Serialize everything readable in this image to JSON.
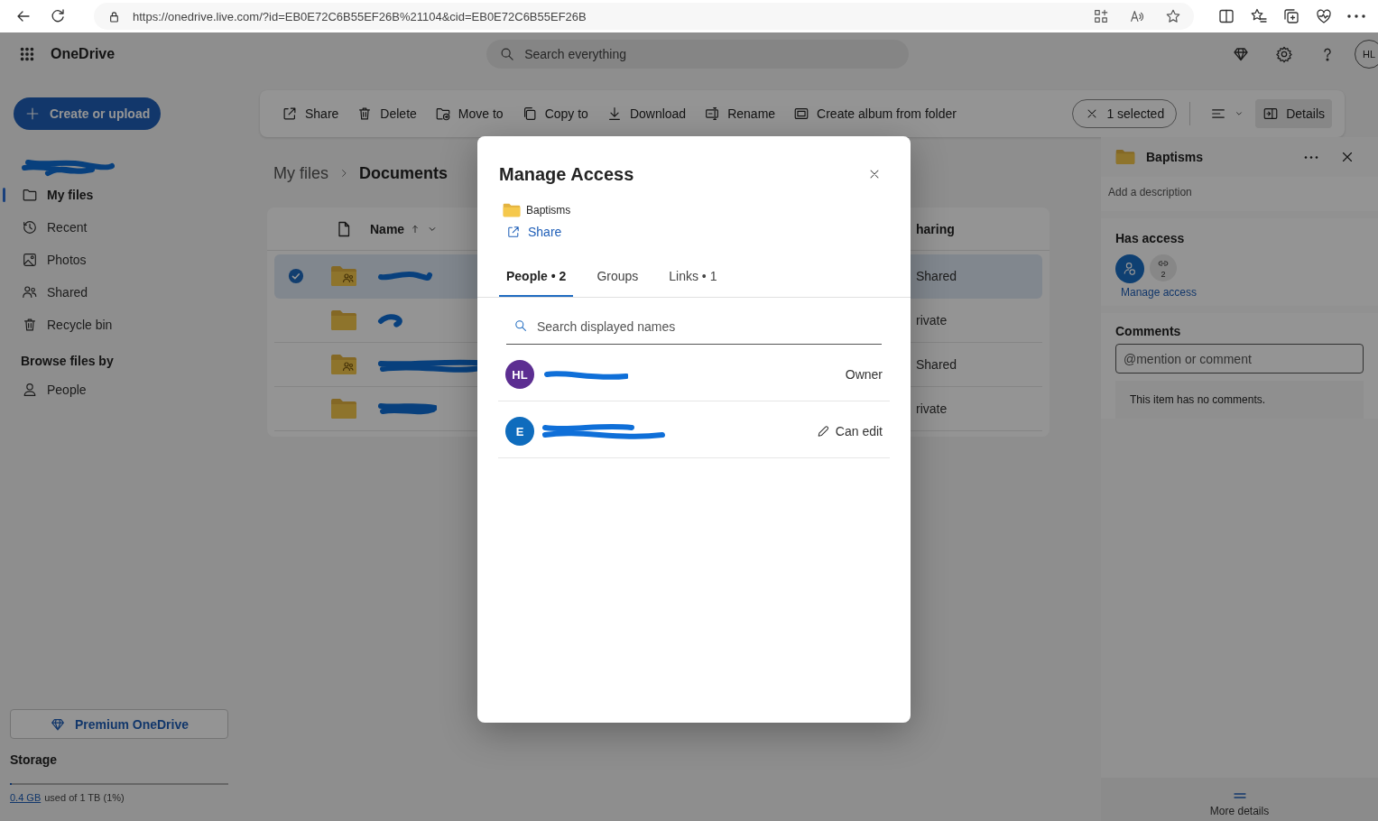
{
  "browser": {
    "url": "https://onedrive.live.com/?id=EB0E72C6B55EF26B%21104&cid=EB0E72C6B55EF26B"
  },
  "app": {
    "name": "OneDrive",
    "search_placeholder": "Search everything",
    "avatar": "HL"
  },
  "sidebar": {
    "create_button": "Create or upload",
    "items": [
      {
        "label": "My files",
        "selected": true
      },
      {
        "label": "Recent",
        "selected": false
      },
      {
        "label": "Photos",
        "selected": false
      },
      {
        "label": "Shared",
        "selected": false
      },
      {
        "label": "Recycle bin",
        "selected": false
      }
    ],
    "browse_heading": "Browse files by",
    "browse_items": [
      {
        "label": "People",
        "selected": false
      }
    ],
    "premium_button": "Premium OneDrive",
    "storage": {
      "heading": "Storage",
      "level": 0.01,
      "used": "0.4 GB",
      "detail": "used of 1 TB (1%)"
    }
  },
  "toolbar": {
    "actions": [
      {
        "label": "Share"
      },
      {
        "label": "Delete"
      },
      {
        "label": "Move to"
      },
      {
        "label": "Copy to"
      },
      {
        "label": "Download"
      },
      {
        "label": "Rename"
      },
      {
        "label": "Create album from folder"
      }
    ],
    "selection": "1 selected",
    "details_button": "Details"
  },
  "breadcrumb": [
    "My files",
    "Documents"
  ],
  "file_list": {
    "name_column": "Name",
    "sharing_column": "haring",
    "rows": [
      {
        "shared": true,
        "selected": true,
        "sharing": "Shared"
      },
      {
        "shared": false,
        "selected": false,
        "sharing": "rivate"
      },
      {
        "shared": true,
        "selected": false,
        "sharing": "Shared"
      },
      {
        "shared": false,
        "selected": false,
        "sharing": "rivate"
      }
    ]
  },
  "dialog": {
    "title": "Manage Access",
    "item": "Baptisms",
    "share_link": "Share",
    "tabs": [
      {
        "label": "People • 2",
        "selected": true
      },
      {
        "label": "Groups",
        "selected": false
      },
      {
        "label": "Links • 1",
        "selected": false
      }
    ],
    "search_placeholder": "Search displayed names",
    "people": [
      {
        "kind": "owner",
        "initials": "HL",
        "color": "#5c2e91",
        "role": "Owner"
      },
      {
        "kind": "editor",
        "initials": "E",
        "color": "#0f6cbd",
        "role": "Can edit"
      }
    ]
  },
  "details": {
    "title": "Baptisms",
    "description_placeholder": "Add a description",
    "has_access_heading": "Has access",
    "link_count": "2",
    "manage_access": "Manage access",
    "comments_heading": "Comments",
    "comment_placeholder": "@mention or comment",
    "no_comments": "This item has no comments.",
    "more_details": "More details"
  }
}
